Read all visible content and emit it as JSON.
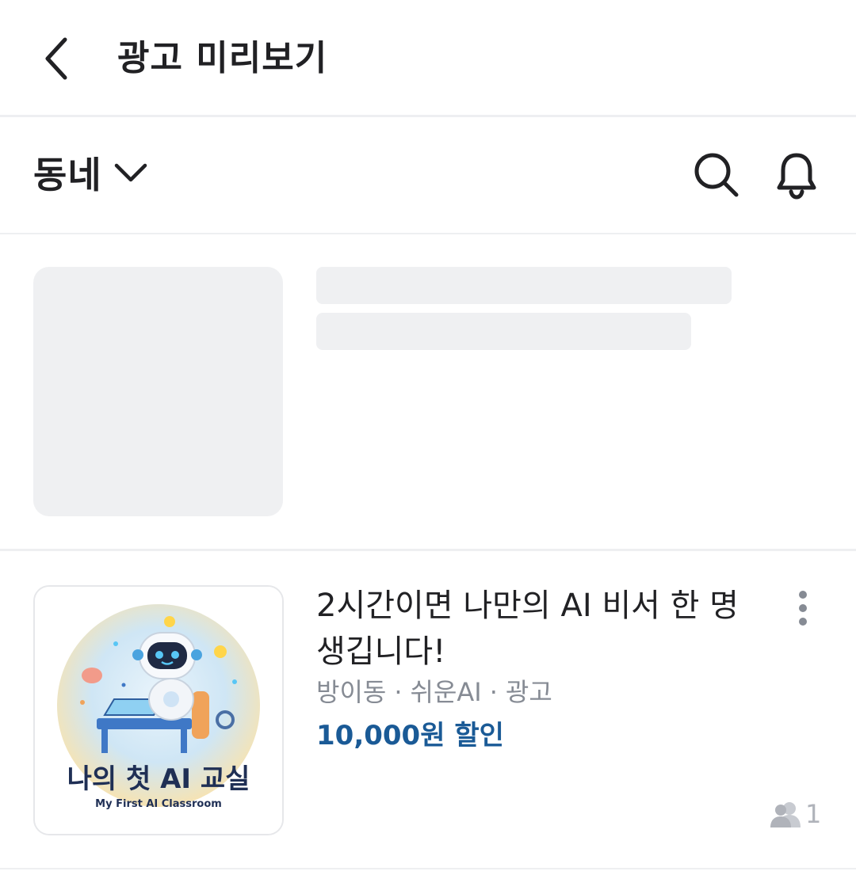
{
  "topbar": {
    "title": "광고 미리보기",
    "back_icon": "chevron-left-icon"
  },
  "navbar": {
    "region_label": "동네",
    "region_chevron_icon": "chevron-down-icon",
    "search_icon": "search-icon",
    "bell_icon": "bell-icon"
  },
  "ad": {
    "title": "2시간이면 나만의 AI 비서 한 명 생깁니다!",
    "meta": {
      "location": "방이동",
      "seller": "쉬운AI",
      "badge": "광고",
      "separator": "·"
    },
    "price": "10,000원 할인",
    "participants": "1",
    "more_icon": "more-vertical-icon",
    "people_icon": "people-icon",
    "thumbnail": {
      "title": "나의 첫 AI 교실",
      "subtitle": "My First AI Classroom",
      "robot_badge": "AI"
    }
  },
  "colors": {
    "text_primary": "#212124",
    "text_secondary": "#868b94",
    "price": "#1a5a96",
    "skeleton": "#eff0f2",
    "divider": "#eeeff1"
  }
}
